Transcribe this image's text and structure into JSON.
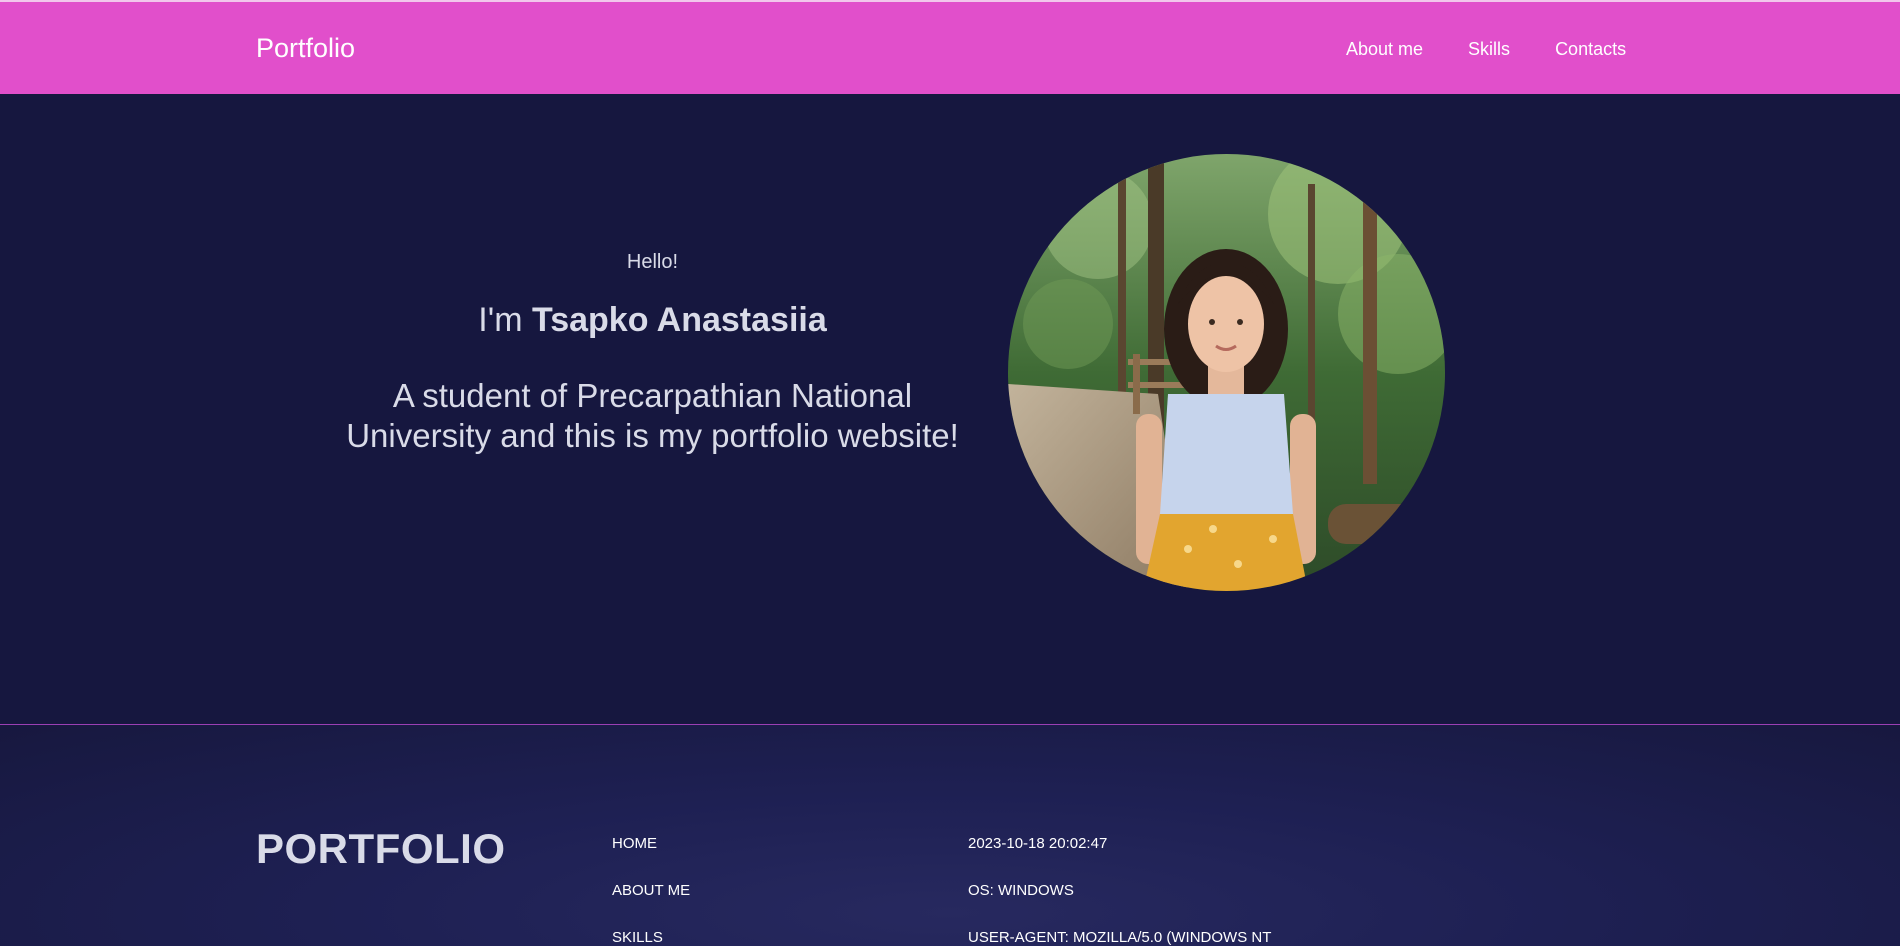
{
  "header": {
    "brand": "Portfolio",
    "nav": [
      {
        "label": "About me"
      },
      {
        "label": "Skills"
      },
      {
        "label": "Contacts"
      }
    ]
  },
  "hero": {
    "greeting": "Hello!",
    "intro_prefix": "I'm ",
    "name": "Tsapko Anastasiia",
    "tagline": "A student of Precarpathian National University and this is my portfolio website!",
    "photo_icon": "profile-photo"
  },
  "footer": {
    "logo": "PORTFOLIO",
    "links": [
      {
        "label": "HOME"
      },
      {
        "label": "ABOUT ME"
      },
      {
        "label": "SKILLS"
      }
    ],
    "info": {
      "datetime": "2023-10-18 20:02:47",
      "os": "OS: WINDOWS",
      "user_agent": "USER-AGENT: MOZILLA/5.0 (WINDOWS NT"
    }
  },
  "colors": {
    "header_bg": "#e14fcb",
    "page_bg": "#16173f",
    "divider": "#9b3fb4",
    "text": "#d9dbe8"
  }
}
